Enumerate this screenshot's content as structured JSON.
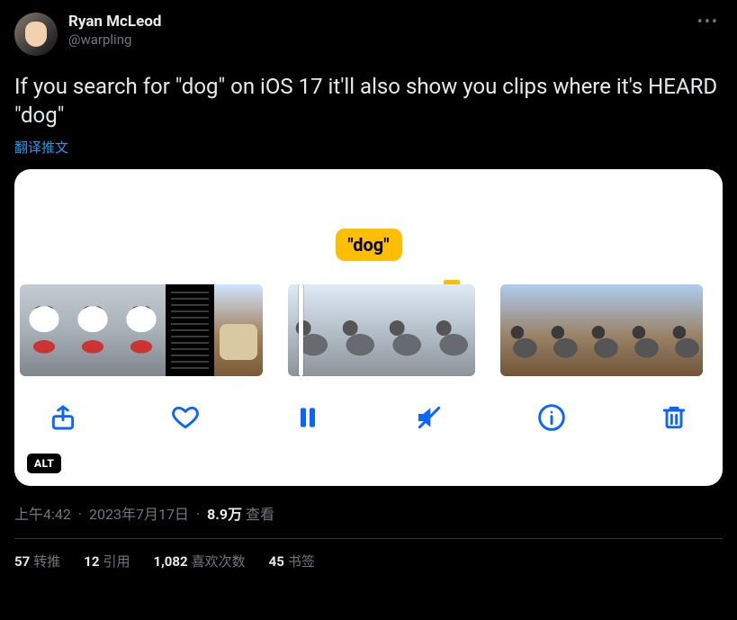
{
  "author": {
    "display_name": "Ryan McLeod",
    "handle": "@warpling"
  },
  "tweet_text": "If you search for \"dog\" on iOS 17 it'll also show you clips where it's HEARD \"dog\"",
  "translate_label": "翻译推文",
  "media": {
    "caption_pill": "\"dog\"",
    "alt_badge": "ALT"
  },
  "meta": {
    "time": "上午4:42",
    "date": "2023年7月17日",
    "views_number": "8.9万",
    "views_label": "查看"
  },
  "stats": {
    "retweets_num": "57",
    "retweets_label": "转推",
    "quotes_num": "12",
    "quotes_label": "引用",
    "likes_num": "1,082",
    "likes_label": "喜欢次数",
    "bookmarks_num": "45",
    "bookmarks_label": "书签"
  }
}
